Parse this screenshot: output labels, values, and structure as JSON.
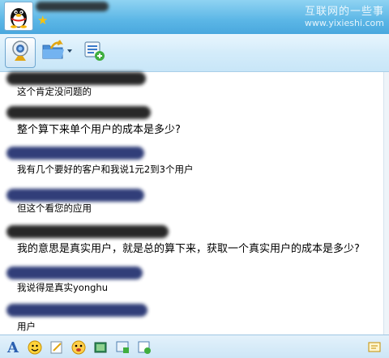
{
  "window": {
    "watermark_line1": "互联网的一些事",
    "watermark_line2": "www.yixieshi.com"
  },
  "toolbar": {
    "buttons": [
      {
        "name": "video-call",
        "icon": "webcam-icon"
      },
      {
        "name": "send-file",
        "icon": "folder-arrow-icon"
      },
      {
        "name": "apps",
        "icon": "app-add-icon"
      }
    ]
  },
  "messages": [
    {
      "text": "这个肯定没问题的"
    },
    {
      "text": "整个算下来单个用户的成本是多少?"
    },
    {
      "text": "我有几个要好的客户和我说1元2到3个用户"
    },
    {
      "text": "但这个看您的应用"
    },
    {
      "text": "我的意思是真实用户，就是总的算下来，获取一个真实用户的成本是多少?"
    },
    {
      "text": "我说得是真实yonghu"
    },
    {
      "text": "用户"
    }
  ],
  "bottom_toolbar": {
    "font_button_glyph": "A",
    "icons": [
      "font-icon",
      "emoticon-icon",
      "note-icon",
      "magic-face-icon",
      "screenshot-icon",
      "image-icon",
      "share-icon",
      "more-icon"
    ]
  },
  "colors": {
    "title_bar": "#5bb6e6",
    "toolbar": "#d4ecfa"
  }
}
